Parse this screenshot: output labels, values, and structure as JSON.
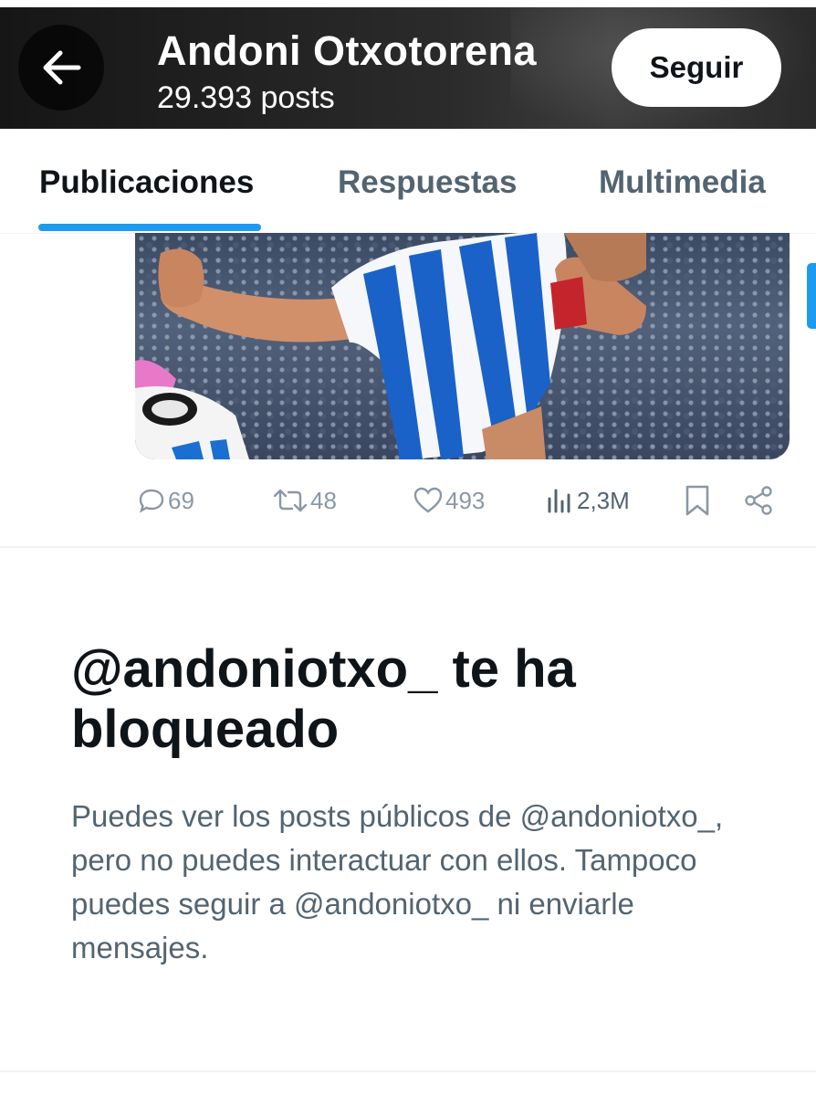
{
  "header": {
    "title": "Andoni Otxotorena",
    "posts_count": "29.393 posts",
    "follow_label": "Seguir"
  },
  "tabs": [
    {
      "label": "Publicaciones",
      "active": true
    },
    {
      "label": "Respuestas",
      "active": false
    },
    {
      "label": "Multimedia",
      "active": false
    }
  ],
  "post": {
    "media_description": "photo",
    "actions": {
      "replies": "69",
      "reposts": "48",
      "likes": "493",
      "views": "2,3M"
    }
  },
  "blocked": {
    "title": "@andoniotxo_ te ha bloqueado",
    "description": "Puedes ver los posts públicos de @andoniotxo_, pero no puedes interactuar con ellos. Tampoco puedes seguir a @andoniotxo_ ni enviarle mensajes."
  },
  "colors": {
    "accent": "#1d9bf0",
    "text_primary": "#0f1419",
    "text_secondary": "#536471"
  },
  "icons": {
    "back": "arrow-left-icon",
    "reply": "speech-bubble-icon",
    "repost": "repost-arrows-icon",
    "like": "heart-icon",
    "views": "bar-chart-icon",
    "bookmark": "bookmark-icon",
    "share": "share-icon"
  }
}
